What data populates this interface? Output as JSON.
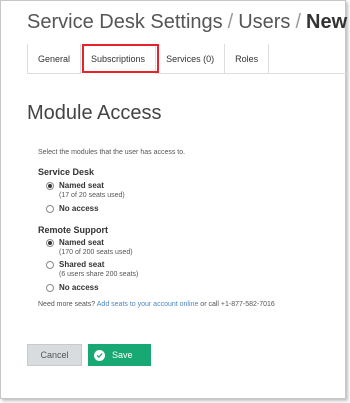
{
  "title": {
    "part1": "Service Desk Settings",
    "sep1": "/",
    "part2": "Users",
    "sep2": "/",
    "part3": "New"
  },
  "tabs": [
    {
      "label": "General"
    },
    {
      "label": "Subscriptions",
      "active": true
    },
    {
      "label": "Services (0)"
    },
    {
      "label": "Roles"
    }
  ],
  "section": {
    "heading": "Module Access",
    "intro": "Select the modules that the user has access to."
  },
  "service_desk": {
    "title": "Service Desk",
    "options": [
      {
        "label": "Named seat",
        "sub": "(17 of 20 seats used)",
        "selected": true
      },
      {
        "label": "No access",
        "sub": "",
        "selected": false
      }
    ]
  },
  "remote_support": {
    "title": "Remote Support",
    "options": [
      {
        "label": "Named seat",
        "sub": "(170 of 200 seats used)",
        "selected": true
      },
      {
        "label": "Shared seat",
        "sub": "(6 users share 200 seats)",
        "selected": false
      },
      {
        "label": "No access",
        "sub": "",
        "selected": false
      }
    ]
  },
  "need_more": {
    "prefix": "Need more seats?",
    "link": "Add seats to your account online",
    "suffix": "or call +1-877-582-7016"
  },
  "buttons": {
    "cancel": "Cancel",
    "save": "Save"
  },
  "colors": {
    "save": "#17a873",
    "highlight": "#e8222a",
    "link": "#4a86c5"
  }
}
